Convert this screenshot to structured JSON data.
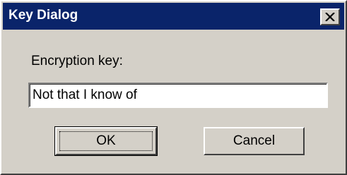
{
  "dialog": {
    "title": "Key Dialog",
    "field_label": "Encryption key:",
    "key_value": "Not that I know of",
    "ok_label": "OK",
    "cancel_label": "Cancel"
  },
  "icons": {
    "close": "close-icon"
  },
  "colors": {
    "titlebar": "#0a246a",
    "window_bg": "#d4d0c8",
    "title_text": "#ffffff"
  }
}
